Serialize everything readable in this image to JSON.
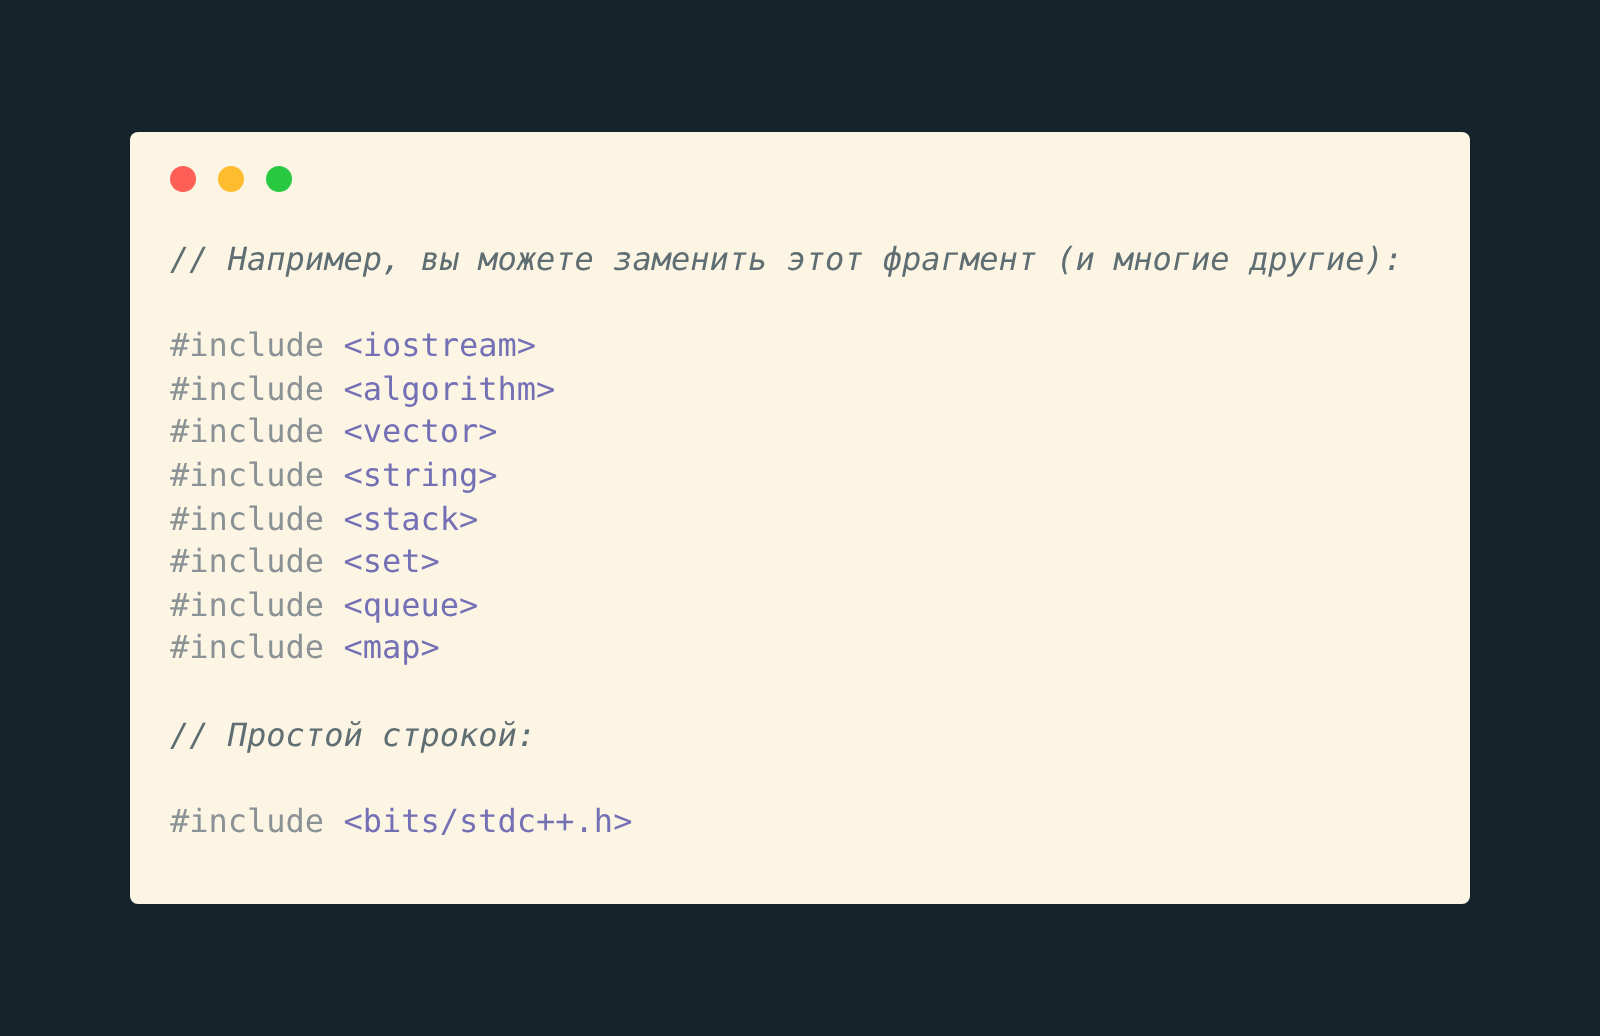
{
  "code_window": {
    "lines": [
      {
        "kind": "comment",
        "text": "// Например, вы можете заменить этот фрагмент (и многие другие):"
      },
      {
        "kind": "blank"
      },
      {
        "kind": "include",
        "directive": "#include",
        "header": "<iostream>"
      },
      {
        "kind": "include",
        "directive": "#include",
        "header": "<algorithm>"
      },
      {
        "kind": "include",
        "directive": "#include",
        "header": "<vector>"
      },
      {
        "kind": "include",
        "directive": "#include",
        "header": "<string>"
      },
      {
        "kind": "include",
        "directive": "#include",
        "header": "<stack>"
      },
      {
        "kind": "include",
        "directive": "#include",
        "header": "<set>"
      },
      {
        "kind": "include",
        "directive": "#include",
        "header": "<queue>"
      },
      {
        "kind": "include",
        "directive": "#include",
        "header": "<map>"
      },
      {
        "kind": "blank"
      },
      {
        "kind": "comment",
        "text": "// Простой строкой:"
      },
      {
        "kind": "blank"
      },
      {
        "kind": "include",
        "directive": "#include",
        "header": "<bits/stdc++.h>"
      }
    ]
  }
}
